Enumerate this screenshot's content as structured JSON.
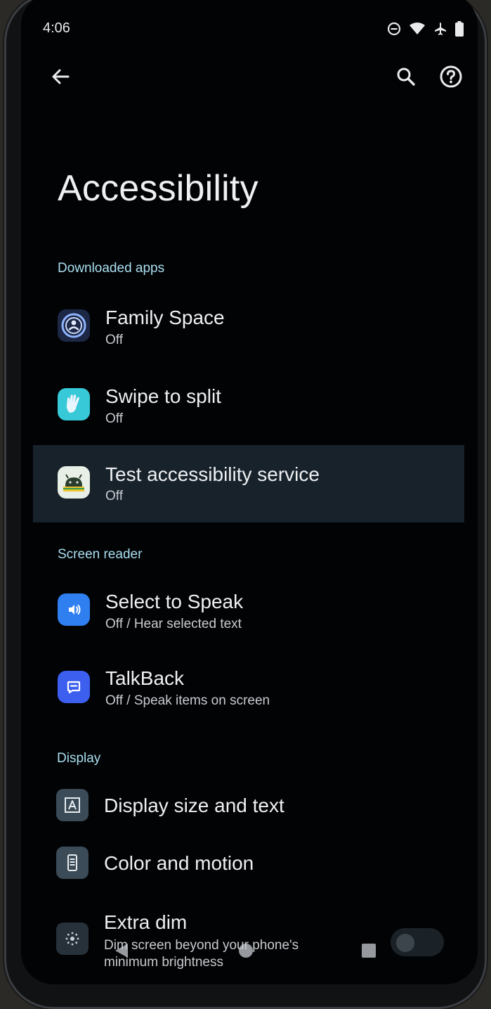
{
  "status_bar": {
    "time": "4:06",
    "icons": [
      "do-not-disturb-icon",
      "wifi-icon",
      "airplane-icon",
      "battery-icon"
    ]
  },
  "toolbar": {
    "back_icon": "arrow-back-icon",
    "search_icon": "search-icon",
    "help_icon": "help-icon"
  },
  "page": {
    "title": "Accessibility"
  },
  "sections": {
    "downloaded_apps": {
      "header": "Downloaded apps",
      "items": [
        {
          "title": "Family Space",
          "subtitle": "Off",
          "icon": "family-space-icon"
        },
        {
          "title": "Swipe to split",
          "subtitle": "Off",
          "icon": "swipe-hand-icon"
        },
        {
          "title": "Test accessibility service",
          "subtitle": "Off",
          "icon": "android-app-icon"
        }
      ]
    },
    "screen_reader": {
      "header": "Screen reader",
      "items": [
        {
          "title": "Select to Speak",
          "subtitle": "Off / Hear selected text",
          "icon": "select-to-speak-icon"
        },
        {
          "title": "TalkBack",
          "subtitle": "Off / Speak items on screen",
          "icon": "talkback-icon"
        }
      ]
    },
    "display": {
      "header": "Display",
      "items": [
        {
          "title": "Display size and text",
          "icon": "text-size-icon"
        },
        {
          "title": "Color and motion",
          "icon": "phone-color-icon"
        },
        {
          "title": "Extra dim",
          "subtitle": "Dim screen beyond your phone's minimum brightness",
          "icon": "extra-dim-icon",
          "toggle": "off"
        }
      ]
    }
  },
  "colors": {
    "background": "#020305",
    "accent_header": "#a9dff0",
    "highlight": "#18222b",
    "select_to_speak": "#2f7ff0",
    "talkback": "#3c5ff0",
    "swipe_to_split": "#38c9d8"
  },
  "nav_bar": {
    "icons": [
      "nav-back-icon",
      "nav-home-icon",
      "nav-recents-icon"
    ]
  }
}
